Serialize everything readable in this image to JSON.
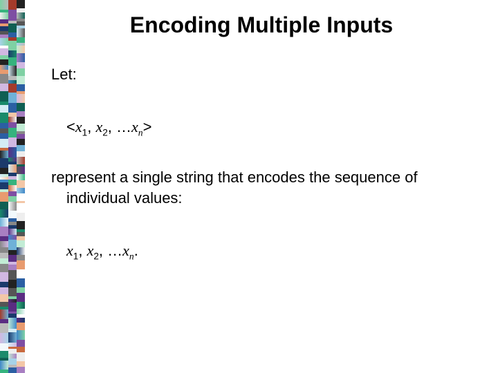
{
  "title": "Encoding Multiple Inputs",
  "let_label": "Let:",
  "tuple": {
    "open": "<",
    "var": "x",
    "sub1": "1",
    "sep": ", ",
    "sub2": "2",
    "ellipsis": ", …",
    "subn": "n",
    "close": ">"
  },
  "represent_line1": "represent a single string that encodes the sequence of",
  "represent_line2": "individual values:",
  "seq": {
    "var": "x",
    "sub1": "1",
    "sep": ", ",
    "sub2": "2",
    "ellipsis": ", …",
    "subn": "n",
    "period": "."
  }
}
